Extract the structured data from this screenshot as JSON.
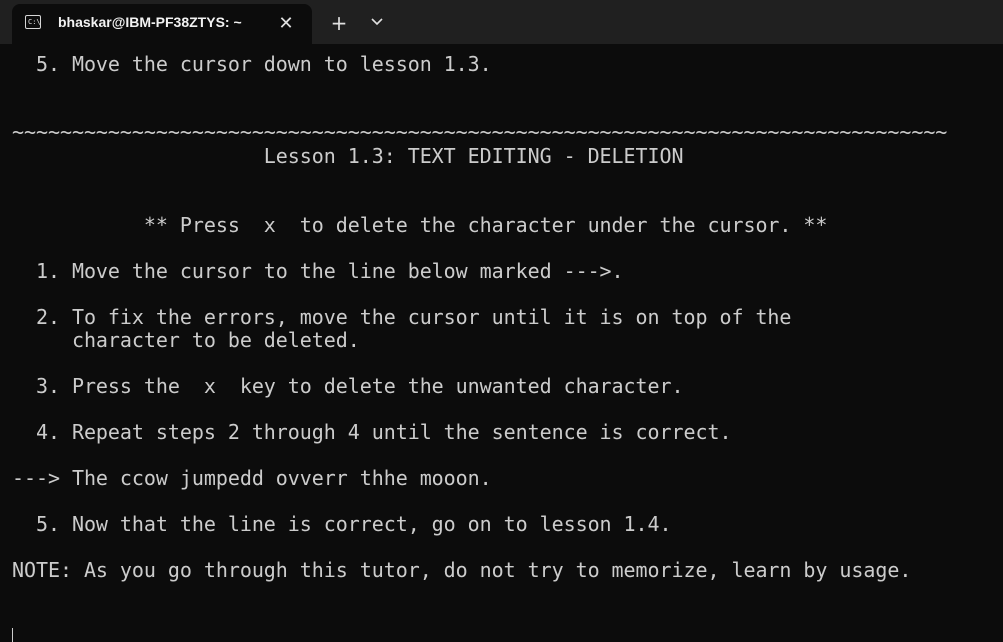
{
  "window": {
    "tab_title": "bhaskar@IBM-PF38ZTYS: ~",
    "tab_icon_glyph": "C:\\",
    "close_glyph": "✕",
    "new_tab_glyph": "+",
    "colors": {
      "background": "#0c0c0c",
      "titlebar": "#202020",
      "text": "#cccccc"
    }
  },
  "terminal": {
    "lines": [
      "  5. Move the cursor down to lesson 1.3.",
      "~~~~~~~~~~~~~~~~~~~~~~~~~~~~~~~~~~~~~~~~~~~~~~~~~~~~~~~~~~~~~~~~~~~~~~~~~~~~~~",
      "                     Lesson 1.3: TEXT EDITING - DELETION",
      "           ** Press  x  to delete the character under the cursor. **",
      "  1. Move the cursor to the line below marked --->.",
      "  2. To fix the errors, move the cursor until it is on top of the",
      "     character to be deleted.",
      "  3. Press the  x  key to delete the unwanted character.",
      "  4. Repeat steps 2 through 4 until the sentence is correct.",
      "---> The ccow jumpedd ovverr thhe mooon.",
      "  5. Now that the line is correct, go on to lesson 1.4.",
      "NOTE: As you go through this tutor, do not try to memorize, learn by usage."
    ]
  }
}
